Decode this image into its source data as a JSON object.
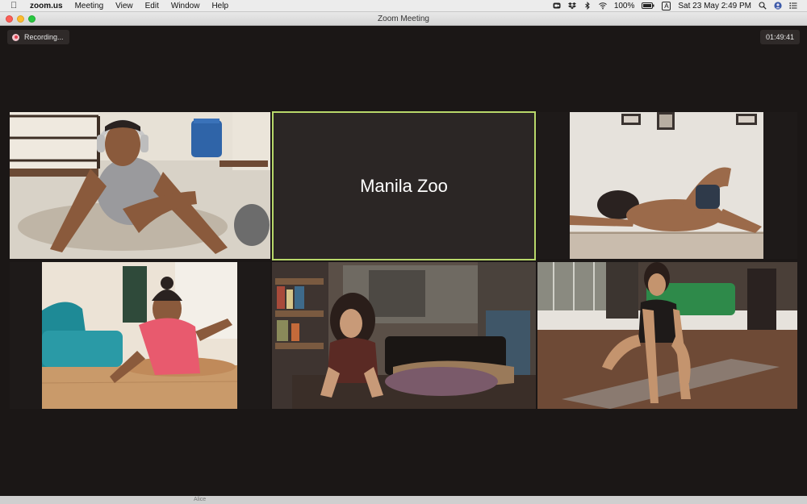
{
  "menubar": {
    "app_name": "zoom.us",
    "items": [
      "Meeting",
      "View",
      "Edit",
      "Window",
      "Help"
    ],
    "battery": "100%",
    "input_source": "A",
    "datetime": "Sat 23 May  2:49 PM"
  },
  "window": {
    "title": "Zoom Meeting"
  },
  "meeting": {
    "recording_label": "Recording...",
    "elapsed": "01:49:41",
    "name_tile": "Manila Zoo",
    "active_speaker_color": "#b8d86a"
  },
  "footer": {
    "partial_label": "Alice"
  },
  "icons": [
    "apple-icon",
    "zoom-icon",
    "dropbox-icon",
    "bluetooth-icon",
    "wifi-icon",
    "battery-icon",
    "spotlight-search-icon",
    "user-avatar-icon",
    "control-center-icon"
  ]
}
